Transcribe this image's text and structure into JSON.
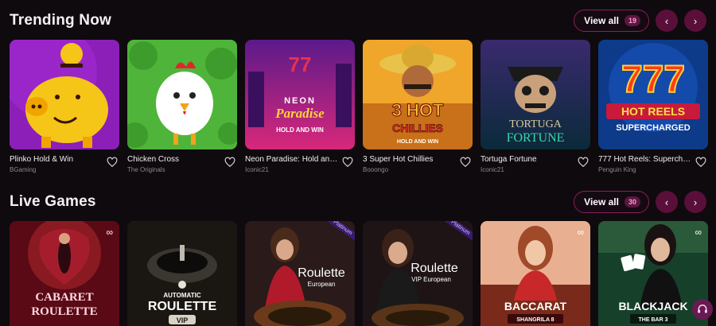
{
  "trending": {
    "title": "Trending Now",
    "view_all": "View all",
    "count": "19",
    "games": [
      {
        "title": "Plinko Hold & Win",
        "provider": "BGaming"
      },
      {
        "title": "Chicken Cross",
        "provider": "The Originals"
      },
      {
        "title": "Neon Paradise: Hold and...",
        "provider": "Iconic21"
      },
      {
        "title": "3 Super Hot Chillies",
        "provider": "Booongo"
      },
      {
        "title": "Tortuga Fortune",
        "provider": "Iconic21"
      },
      {
        "title": "777 Hot Reels: Supercharged",
        "provider": "Penguin King"
      }
    ]
  },
  "live": {
    "title": "Live Games",
    "view_all": "View all",
    "count": "30",
    "games": [
      {
        "art_line1": "CABARET",
        "art_line2": "ROULETTE"
      },
      {
        "art_line1": "AUTOMATIC",
        "art_line2": "ROULETTE",
        "art_line3": "VIP"
      },
      {
        "art_line1": "Roulette",
        "art_line2": "European",
        "tag": "Platinum"
      },
      {
        "art_line1": "Roulette",
        "art_line2": "VIP European",
        "tag": "Platinum"
      },
      {
        "art_line1": "BACCARAT",
        "art_line2": "SHANGRILA 8"
      },
      {
        "art_line1": "BLACKJACK",
        "art_line2": "THE BAR 3"
      }
    ]
  },
  "icons": {
    "prev": "chevron-left-icon",
    "next": "chevron-right-icon",
    "favorite": "heart-icon",
    "support": "headset-icon"
  },
  "colors": {
    "background": "#0f0a0e",
    "accent": "#8a1e5c",
    "nav": "#5a0f3a"
  }
}
